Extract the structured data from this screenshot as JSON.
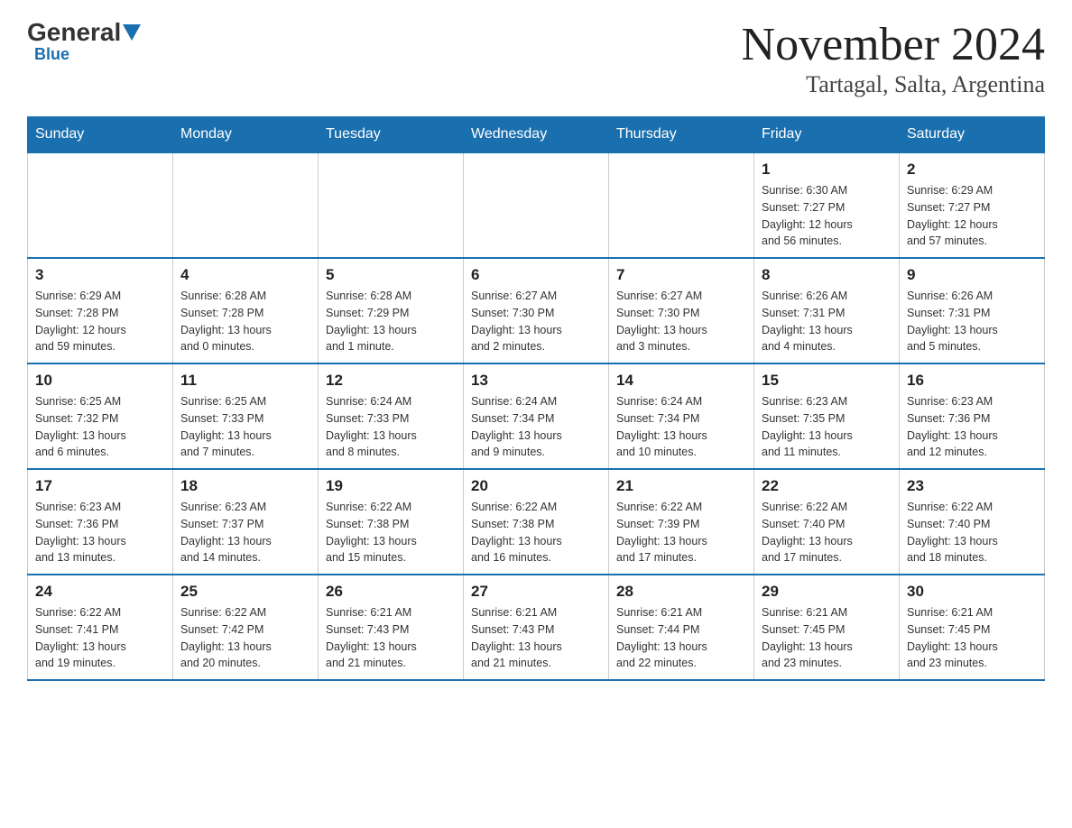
{
  "logo": {
    "general": "General",
    "blue": "Blue",
    "subtitle": "Blue"
  },
  "header": {
    "title": "November 2024",
    "location": "Tartagal, Salta, Argentina"
  },
  "weekdays": [
    "Sunday",
    "Monday",
    "Tuesday",
    "Wednesday",
    "Thursday",
    "Friday",
    "Saturday"
  ],
  "weeks": [
    [
      {
        "day": "",
        "info": ""
      },
      {
        "day": "",
        "info": ""
      },
      {
        "day": "",
        "info": ""
      },
      {
        "day": "",
        "info": ""
      },
      {
        "day": "",
        "info": ""
      },
      {
        "day": "1",
        "info": "Sunrise: 6:30 AM\nSunset: 7:27 PM\nDaylight: 12 hours\nand 56 minutes."
      },
      {
        "day": "2",
        "info": "Sunrise: 6:29 AM\nSunset: 7:27 PM\nDaylight: 12 hours\nand 57 minutes."
      }
    ],
    [
      {
        "day": "3",
        "info": "Sunrise: 6:29 AM\nSunset: 7:28 PM\nDaylight: 12 hours\nand 59 minutes."
      },
      {
        "day": "4",
        "info": "Sunrise: 6:28 AM\nSunset: 7:28 PM\nDaylight: 13 hours\nand 0 minutes."
      },
      {
        "day": "5",
        "info": "Sunrise: 6:28 AM\nSunset: 7:29 PM\nDaylight: 13 hours\nand 1 minute."
      },
      {
        "day": "6",
        "info": "Sunrise: 6:27 AM\nSunset: 7:30 PM\nDaylight: 13 hours\nand 2 minutes."
      },
      {
        "day": "7",
        "info": "Sunrise: 6:27 AM\nSunset: 7:30 PM\nDaylight: 13 hours\nand 3 minutes."
      },
      {
        "day": "8",
        "info": "Sunrise: 6:26 AM\nSunset: 7:31 PM\nDaylight: 13 hours\nand 4 minutes."
      },
      {
        "day": "9",
        "info": "Sunrise: 6:26 AM\nSunset: 7:31 PM\nDaylight: 13 hours\nand 5 minutes."
      }
    ],
    [
      {
        "day": "10",
        "info": "Sunrise: 6:25 AM\nSunset: 7:32 PM\nDaylight: 13 hours\nand 6 minutes."
      },
      {
        "day": "11",
        "info": "Sunrise: 6:25 AM\nSunset: 7:33 PM\nDaylight: 13 hours\nand 7 minutes."
      },
      {
        "day": "12",
        "info": "Sunrise: 6:24 AM\nSunset: 7:33 PM\nDaylight: 13 hours\nand 8 minutes."
      },
      {
        "day": "13",
        "info": "Sunrise: 6:24 AM\nSunset: 7:34 PM\nDaylight: 13 hours\nand 9 minutes."
      },
      {
        "day": "14",
        "info": "Sunrise: 6:24 AM\nSunset: 7:34 PM\nDaylight: 13 hours\nand 10 minutes."
      },
      {
        "day": "15",
        "info": "Sunrise: 6:23 AM\nSunset: 7:35 PM\nDaylight: 13 hours\nand 11 minutes."
      },
      {
        "day": "16",
        "info": "Sunrise: 6:23 AM\nSunset: 7:36 PM\nDaylight: 13 hours\nand 12 minutes."
      }
    ],
    [
      {
        "day": "17",
        "info": "Sunrise: 6:23 AM\nSunset: 7:36 PM\nDaylight: 13 hours\nand 13 minutes."
      },
      {
        "day": "18",
        "info": "Sunrise: 6:23 AM\nSunset: 7:37 PM\nDaylight: 13 hours\nand 14 minutes."
      },
      {
        "day": "19",
        "info": "Sunrise: 6:22 AM\nSunset: 7:38 PM\nDaylight: 13 hours\nand 15 minutes."
      },
      {
        "day": "20",
        "info": "Sunrise: 6:22 AM\nSunset: 7:38 PM\nDaylight: 13 hours\nand 16 minutes."
      },
      {
        "day": "21",
        "info": "Sunrise: 6:22 AM\nSunset: 7:39 PM\nDaylight: 13 hours\nand 17 minutes."
      },
      {
        "day": "22",
        "info": "Sunrise: 6:22 AM\nSunset: 7:40 PM\nDaylight: 13 hours\nand 17 minutes."
      },
      {
        "day": "23",
        "info": "Sunrise: 6:22 AM\nSunset: 7:40 PM\nDaylight: 13 hours\nand 18 minutes."
      }
    ],
    [
      {
        "day": "24",
        "info": "Sunrise: 6:22 AM\nSunset: 7:41 PM\nDaylight: 13 hours\nand 19 minutes."
      },
      {
        "day": "25",
        "info": "Sunrise: 6:22 AM\nSunset: 7:42 PM\nDaylight: 13 hours\nand 20 minutes."
      },
      {
        "day": "26",
        "info": "Sunrise: 6:21 AM\nSunset: 7:43 PM\nDaylight: 13 hours\nand 21 minutes."
      },
      {
        "day": "27",
        "info": "Sunrise: 6:21 AM\nSunset: 7:43 PM\nDaylight: 13 hours\nand 21 minutes."
      },
      {
        "day": "28",
        "info": "Sunrise: 6:21 AM\nSunset: 7:44 PM\nDaylight: 13 hours\nand 22 minutes."
      },
      {
        "day": "29",
        "info": "Sunrise: 6:21 AM\nSunset: 7:45 PM\nDaylight: 13 hours\nand 23 minutes."
      },
      {
        "day": "30",
        "info": "Sunrise: 6:21 AM\nSunset: 7:45 PM\nDaylight: 13 hours\nand 23 minutes."
      }
    ]
  ]
}
